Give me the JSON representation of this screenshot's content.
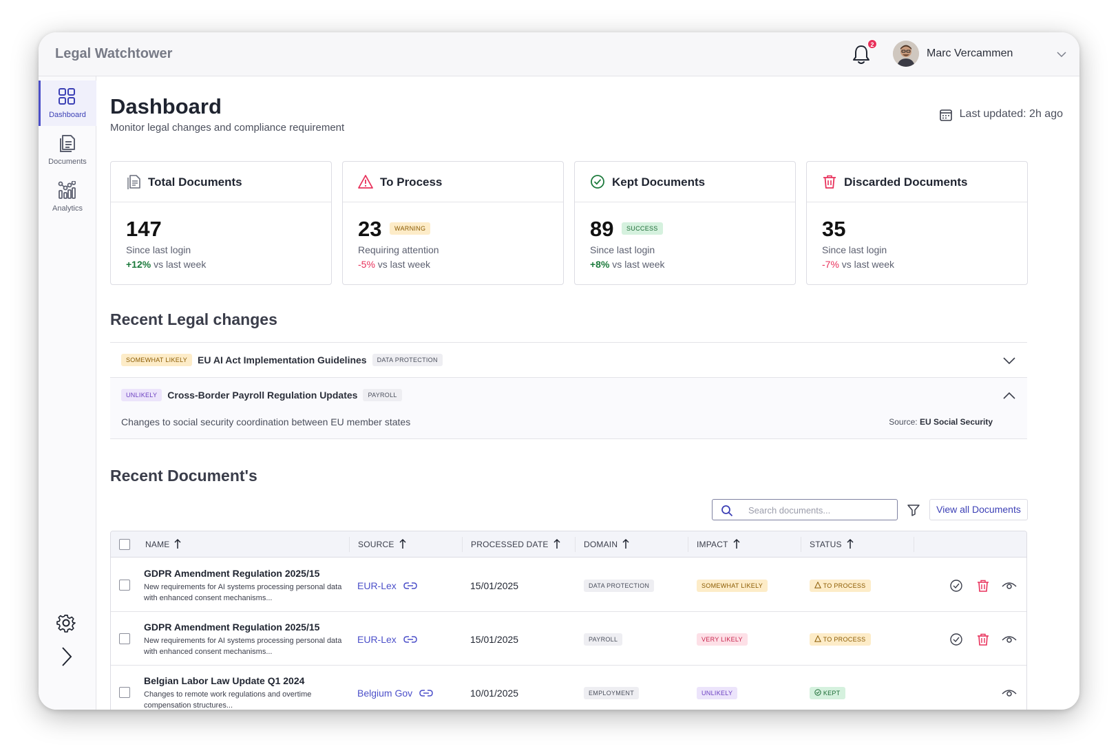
{
  "app": {
    "title": "Legal Watchtower"
  },
  "header": {
    "notification_count": "2",
    "user_name": "Marc Vercammen"
  },
  "sidebar": {
    "items": [
      {
        "label": "Dashboard",
        "icon": "dashboard-grid-icon",
        "active": true
      },
      {
        "label": "Documents",
        "icon": "documents-icon",
        "active": false
      },
      {
        "label": "Analytics",
        "icon": "analytics-icon",
        "active": false
      }
    ],
    "bottom_icons": [
      "gear-icon",
      "chevron-right-icon"
    ]
  },
  "page": {
    "title": "Dashboard",
    "subtitle": "Monitor legal changes and compliance requirement",
    "last_updated": "Last updated: 2h ago"
  },
  "cards": [
    {
      "title": "Total Documents",
      "icon": "document-icon",
      "value": "147",
      "badge": "",
      "sub": "Since last login",
      "trend": "+12%",
      "trend_text": " vs last week"
    },
    {
      "title": "To Process",
      "icon": "warning-triangle-icon",
      "value": "23",
      "badge": "WARNING",
      "sub": "Requiring attention",
      "trend": "-5%",
      "trend_text": " vs last week"
    },
    {
      "title": "Kept Documents",
      "icon": "check-circle-icon",
      "value": "89",
      "badge": "SUCCESS",
      "sub": "Since last login",
      "trend": "+8%",
      "trend_text": " vs last week"
    },
    {
      "title": "Discarded Documents",
      "icon": "trash-icon",
      "value": "35",
      "badge": "",
      "sub": "Since last login",
      "trend": "-7%",
      "trend_text": " vs last week"
    }
  ],
  "recent_changes": {
    "title": "Recent Legal changes",
    "items": [
      {
        "likelihood": "SOMEWHAT LIKELY",
        "title": "EU AI Act Implementation Guidelines",
        "domain": "DATA PROTECTION",
        "expanded": false
      },
      {
        "likelihood": "UNLIKELY",
        "title": "Cross-Border Payroll Regulation Updates",
        "domain": "PAYROLL",
        "expanded": true,
        "description": "Changes to social security coordination between EU member states",
        "source_label": "Source:",
        "source": "EU Social Security"
      }
    ]
  },
  "recent_documents": {
    "title": "Recent Document's",
    "search_placeholder": "Search documents...",
    "view_all_label": "View all Documents",
    "columns": [
      "NAME",
      "SOURCE",
      "PROCESSED DATE",
      "DOMAIN",
      "IMPACT",
      "STATUS"
    ],
    "rows": [
      {
        "name": "GDPR Amendment Regulation 2025/15",
        "description": "New requirements for AI systems processing personal data with enhanced consent mechanisms...",
        "source": "EUR-Lex",
        "date": "15/01/2025",
        "domain": "DATA PROTECTION",
        "impact": "SOMEWHAT LIKELY",
        "status": "TO PROCESS"
      },
      {
        "name": "GDPR Amendment Regulation 2025/15",
        "description": "New requirements for AI systems processing personal data with enhanced consent mechanisms...",
        "source": "EUR-Lex",
        "date": "15/01/2025",
        "domain": "PAYROLL",
        "impact": "VERY LIKELY",
        "status": "TO PROCESS"
      },
      {
        "name": "Belgian Labor Law Update Q1 2024",
        "description": "Changes to remote work regulations and overtime compensation structures...",
        "source": "Belgium Gov",
        "date": "10/01/2025",
        "domain": "EMPLOYMENT",
        "impact": "UNLIKELY",
        "status": "KEPT"
      }
    ]
  },
  "colors": {
    "accent": "#4b4fc9",
    "danger": "#e8315b",
    "success": "#1c7a3c",
    "warning_bg": "#fdecc8"
  }
}
